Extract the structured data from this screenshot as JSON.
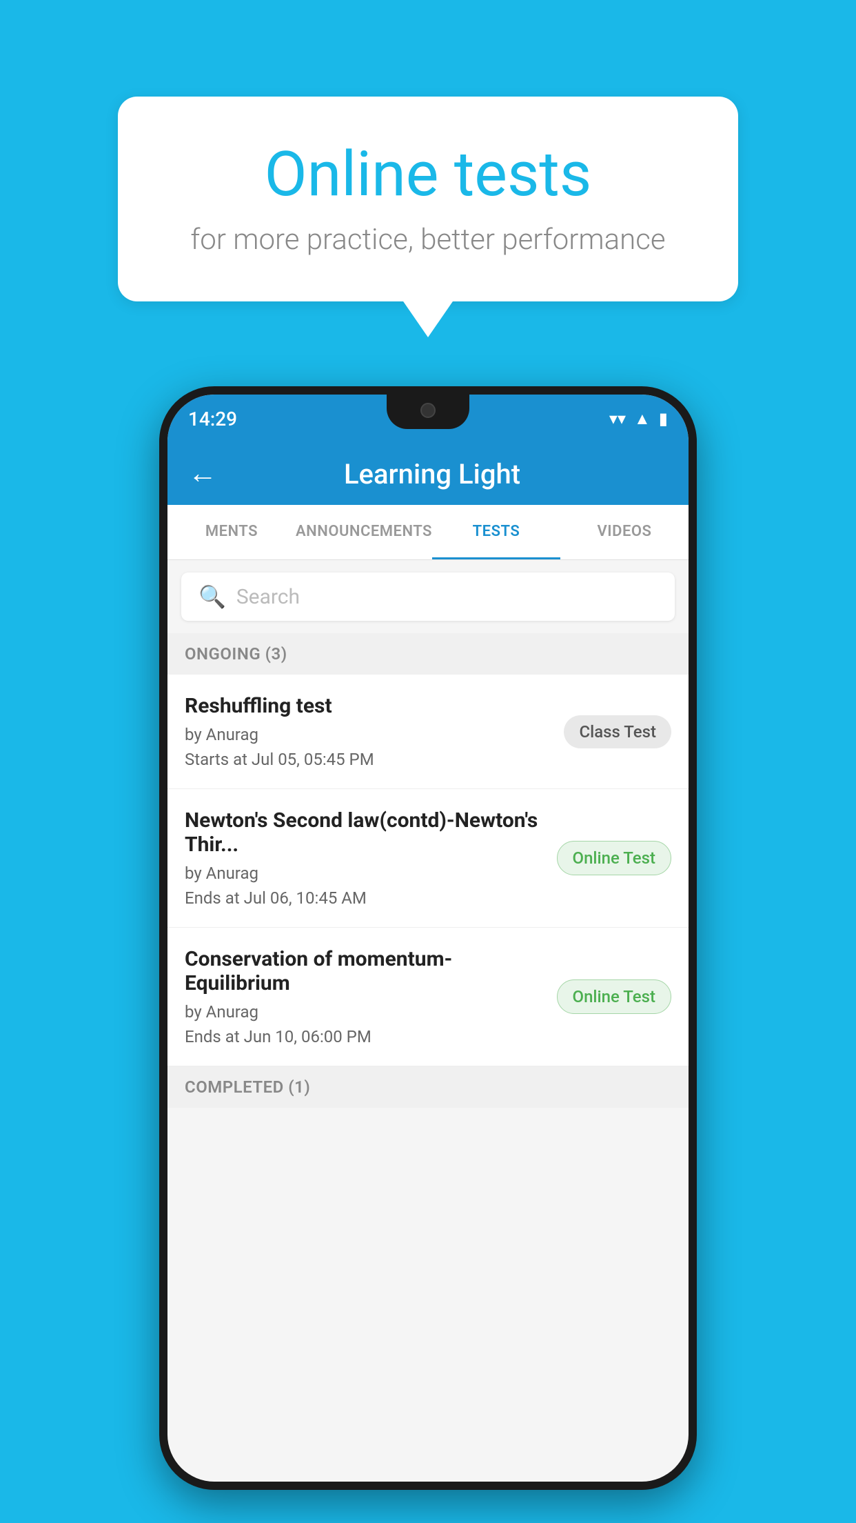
{
  "background_color": "#1ab8e8",
  "speech_bubble": {
    "title": "Online tests",
    "subtitle": "for more practice, better performance"
  },
  "phone": {
    "status_bar": {
      "time": "14:29",
      "icons": [
        "wifi",
        "signal",
        "battery"
      ]
    },
    "app_bar": {
      "back_label": "←",
      "title": "Learning Light"
    },
    "tabs": [
      {
        "label": "MENTS",
        "active": false
      },
      {
        "label": "ANNOUNCEMENTS",
        "active": false
      },
      {
        "label": "TESTS",
        "active": true
      },
      {
        "label": "VIDEOS",
        "active": false
      }
    ],
    "search": {
      "placeholder": "Search"
    },
    "sections": [
      {
        "header": "ONGOING (3)",
        "items": [
          {
            "name": "Reshuffling test",
            "by": "by Anurag",
            "time": "Starts at  Jul 05, 05:45 PM",
            "badge": "Class Test",
            "badge_type": "class"
          },
          {
            "name": "Newton's Second law(contd)-Newton's Thir...",
            "by": "by Anurag",
            "time": "Ends at  Jul 06, 10:45 AM",
            "badge": "Online Test",
            "badge_type": "online"
          },
          {
            "name": "Conservation of momentum-Equilibrium",
            "by": "by Anurag",
            "time": "Ends at  Jun 10, 06:00 PM",
            "badge": "Online Test",
            "badge_type": "online"
          }
        ]
      },
      {
        "header": "COMPLETED (1)",
        "items": []
      }
    ]
  }
}
